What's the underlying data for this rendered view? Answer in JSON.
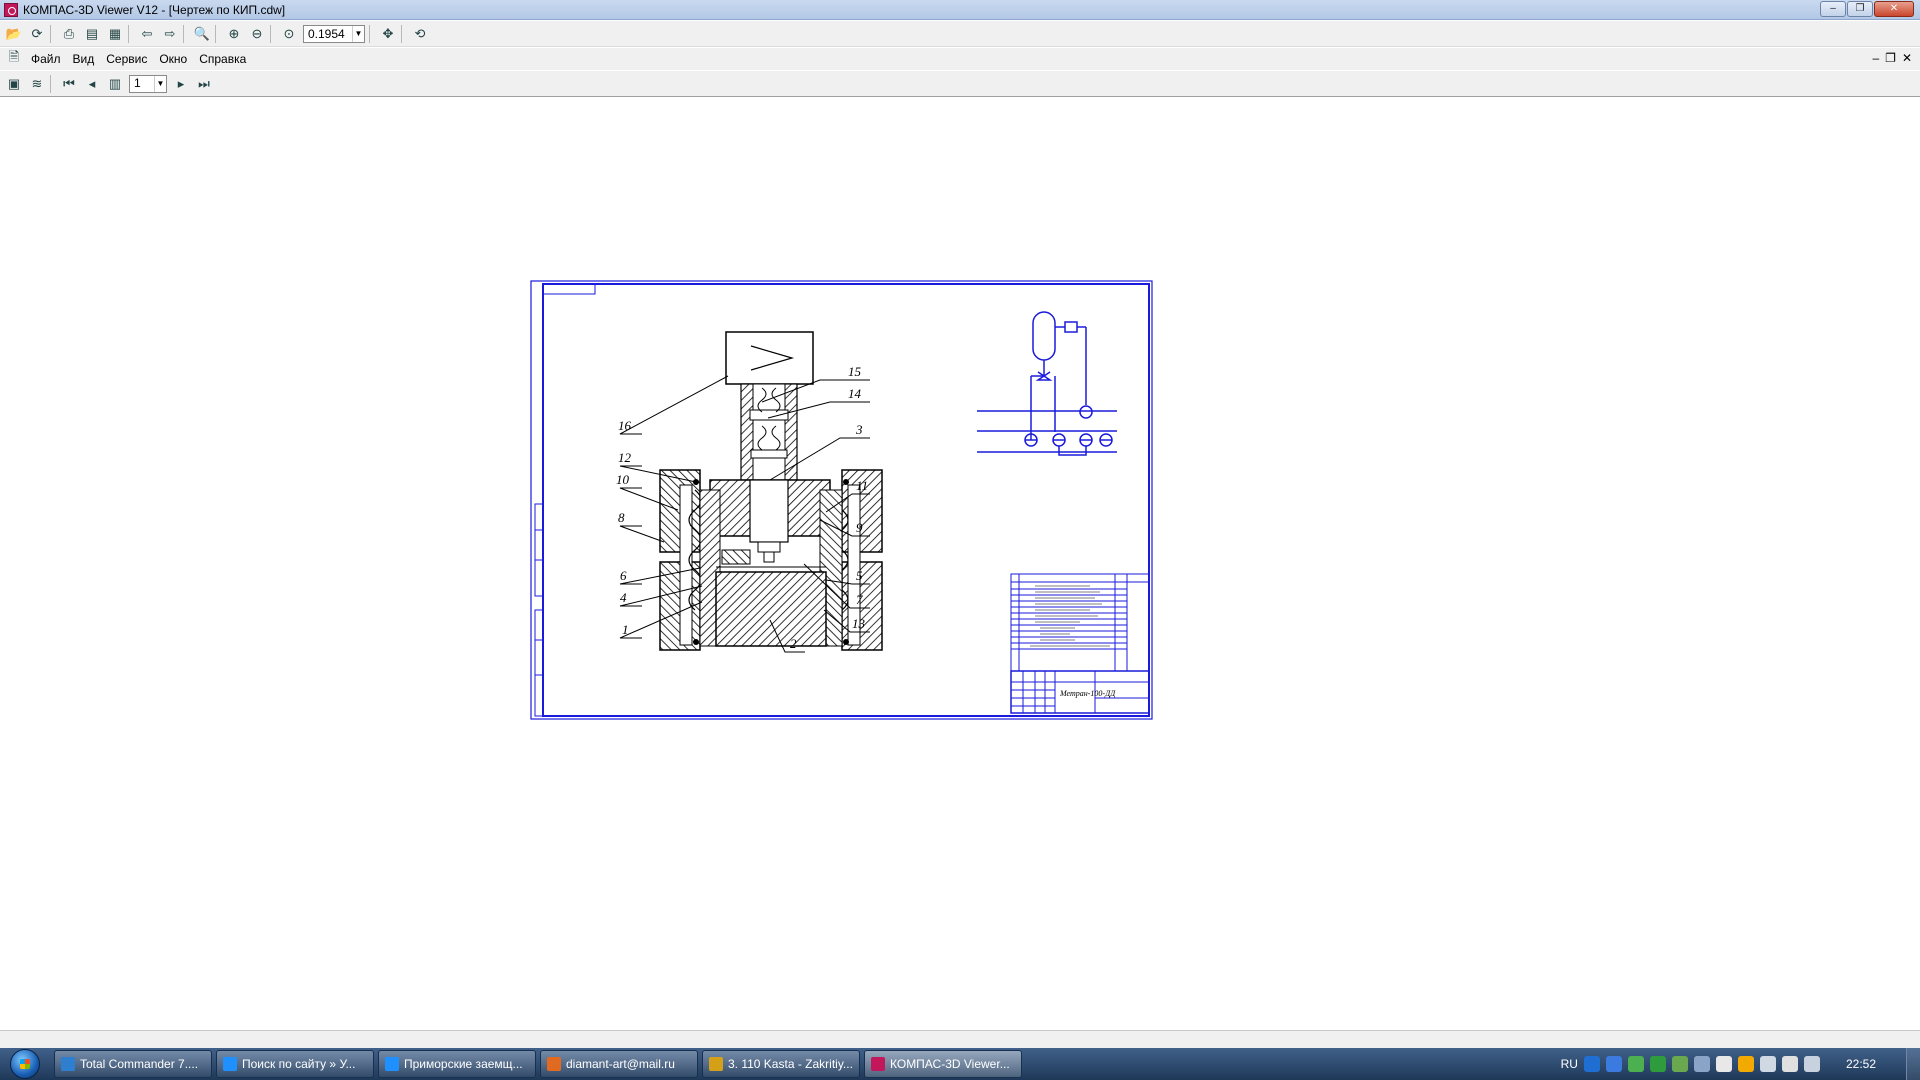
{
  "window": {
    "title": "КОМПАС-3D Viewer V12 - [Чертеж по КИП.cdw]",
    "minimize_label": "‒",
    "maximize_label": "❐",
    "close_label": "✕"
  },
  "toolbar": {
    "zoom_value": "0.1954"
  },
  "menu": {
    "items": [
      "Файл",
      "Вид",
      "Сервис",
      "Окно",
      "Справка"
    ]
  },
  "doc_controls": [
    "‒",
    "❐",
    "✕"
  ],
  "layout_toolbar": {
    "page_value": "1"
  },
  "drawing": {
    "callouts": [
      "15",
      "14",
      "16",
      "3",
      "12",
      "11",
      "10",
      "8",
      "9",
      "6",
      "5",
      "4",
      "7",
      "1",
      "13",
      "2"
    ],
    "title_block_text": "Метран-100-ДД"
  },
  "taskbar": {
    "tasks": [
      {
        "label": "Total Commander 7....",
        "color": "#2f7fd1"
      },
      {
        "label": "Поиск по сайту » У...",
        "color": "#1e90ff"
      },
      {
        "label": "Приморские заемщ...",
        "color": "#1e90ff"
      },
      {
        "label": "diamant-art@mail.ru",
        "color": "#e06a1f"
      },
      {
        "label": "3. 110 Kasta - Zakritiy...",
        "color": "#d4a017"
      },
      {
        "label": "КОМПАС-3D Viewer...",
        "color": "#c2185b"
      }
    ],
    "language": "RU",
    "clock": "22:52"
  },
  "colors": {
    "drawing_line": "#1a1adc",
    "hatch": "#000000",
    "taskbar": "#2a4a72"
  }
}
